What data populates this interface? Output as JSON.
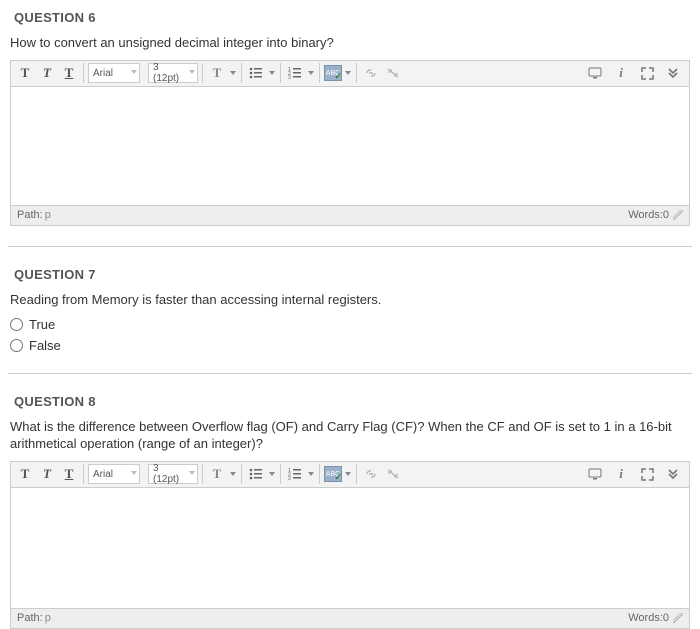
{
  "q6": {
    "title": "QUESTION 6",
    "text": "How to convert an unsigned decimal integer into binary?",
    "editor": {
      "font": "Arial",
      "size": "3 (12pt)",
      "path_label": "Path:",
      "path_value": "p",
      "words_label": "Words:",
      "words_value": "0"
    }
  },
  "q7": {
    "title": "QUESTION 7",
    "text": "Reading from Memory is faster than accessing internal registers.",
    "options": {
      "true": "True",
      "false": "False"
    }
  },
  "q8": {
    "title": "QUESTION 8",
    "text": "What is the difference between Overflow flag (OF) and Carry Flag (CF)? When the CF and OF is set to 1 in a 16-bit arithmetical operation (range of an integer)?",
    "editor": {
      "font": "Arial",
      "size": "3 (12pt)",
      "path_label": "Path:",
      "path_value": "p",
      "words_label": "Words:",
      "words_value": "0"
    }
  }
}
